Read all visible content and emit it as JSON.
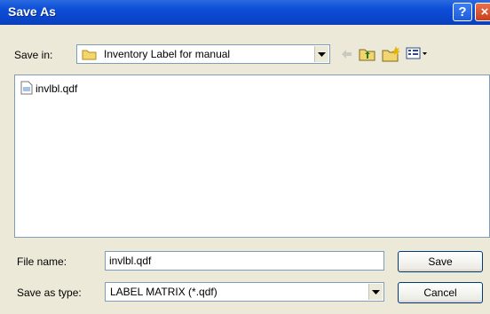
{
  "window": {
    "title": "Save As"
  },
  "titlebar": {
    "help_label": "?",
    "close_label": "×"
  },
  "toolbar": {
    "save_in_label": "Save in:",
    "folder_name": "Inventory Label for manual",
    "icons": [
      "back-icon",
      "up-folder-icon",
      "new-folder-icon",
      "views-menu-icon"
    ]
  },
  "file_list": {
    "items": [
      {
        "name": "invlbl.qdf",
        "icon": "qdf-file-icon"
      }
    ]
  },
  "form": {
    "file_name_label": "File name:",
    "file_name_value": "invlbl.qdf",
    "save_as_type_label": "Save as type:",
    "save_as_type_value": "LABEL MATRIX (*.qdf)"
  },
  "buttons": {
    "save": "Save",
    "cancel": "Cancel"
  },
  "colors": {
    "titlebar": "#0a46cc",
    "dialog_bg": "#ece9d8",
    "border": "#7f9db9"
  }
}
